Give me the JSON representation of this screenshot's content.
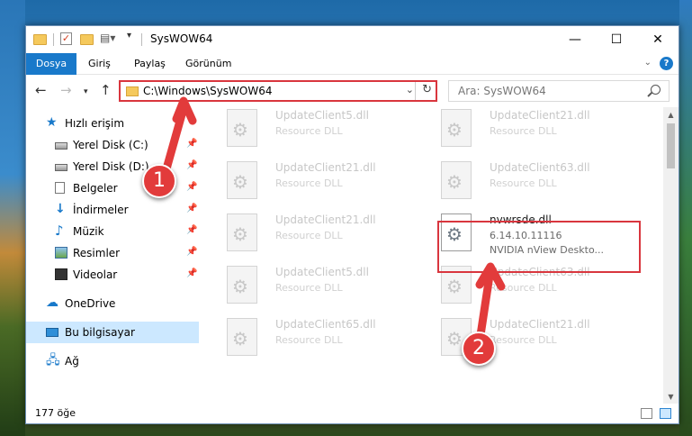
{
  "window": {
    "title": "SysWOW64"
  },
  "ribbon": {
    "tabs": [
      "Dosya",
      "Giriş",
      "Paylaş",
      "Görünüm"
    ]
  },
  "address": {
    "path": "C:\\Windows\\SysWOW64"
  },
  "search": {
    "placeholder": "Ara: SysWOW64"
  },
  "sidebar": {
    "quick_access": "Hızlı erişim",
    "items": [
      {
        "label": "Yerel Disk (C:)",
        "icon": "drive-icon"
      },
      {
        "label": "Yerel Disk (D:)",
        "icon": "drive-icon"
      },
      {
        "label": "Belgeler",
        "icon": "documents-icon"
      },
      {
        "label": "İndirmeler",
        "icon": "downloads-icon"
      },
      {
        "label": "Müzik",
        "icon": "music-icon"
      },
      {
        "label": "Resimler",
        "icon": "pictures-icon"
      },
      {
        "label": "Videolar",
        "icon": "videos-icon"
      }
    ],
    "onedrive": "OneDrive",
    "this_pc": "Bu bilgisayar",
    "network": "Ağ"
  },
  "files": [
    {
      "name": "UpdateClient5.dll",
      "type": "Resource DLL"
    },
    {
      "name": "UpdateClient21.dll",
      "type": "Resource DLL"
    },
    {
      "name": "UpdateClient21.dll",
      "type": "Resource DLL"
    },
    {
      "name": "UpdateClient63.dll",
      "type": "Resource DLL"
    },
    {
      "name": "UpdateClient21.dll",
      "type": "Resource DLL"
    },
    {
      "name": "nvwrsde.dll",
      "version": "6.14.10.11116",
      "description": "NVIDIA nView Deskto..."
    },
    {
      "name": "UpdateClient5.dll",
      "type": "Resource DLL"
    },
    {
      "name": "UpdateClient63.dll",
      "type": "Resource DLL"
    },
    {
      "name": "UpdateClient65.dll",
      "type": "Resource DLL"
    },
    {
      "name": "UpdateClient21.dll",
      "type": "Resource DLL"
    }
  ],
  "status": {
    "count": "177 öğe"
  },
  "annotations": {
    "step1": "1",
    "step2": "2"
  },
  "colors": {
    "accent": "#1979ca",
    "highlight": "#d9363e"
  }
}
